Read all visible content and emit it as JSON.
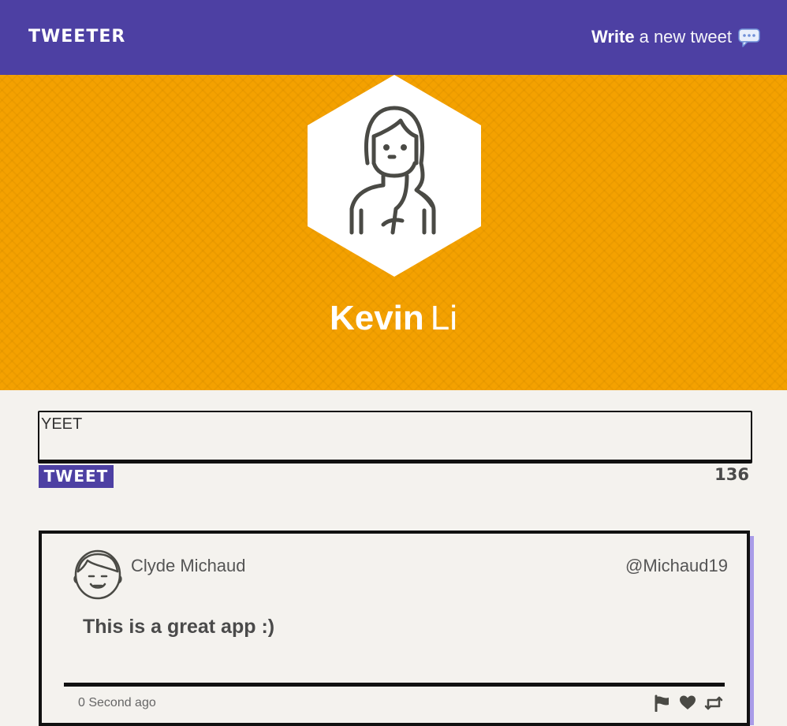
{
  "nav": {
    "brand": "TWEETER",
    "compose_bold": "Write",
    "compose_rest": "a new tweet",
    "compose_icon": "speech-bubble-icon",
    "bg_color": "#4d40a3"
  },
  "profile": {
    "first_name": "Kevin",
    "last_name": "Li",
    "avatar_icon": "woman-avatar-icon",
    "banner_color": "#f4a100"
  },
  "composer": {
    "value": "YEET",
    "button_label": "TWEET",
    "char_count": "136"
  },
  "tweets": [
    {
      "author": "Clyde Michaud",
      "handle": "@Michaud19",
      "text": "This is a great app :)",
      "timestamp": "0 Second ago",
      "avatar_icon": "man-avatar-icon",
      "actions": [
        "flag-icon",
        "heart-icon",
        "retweet-icon"
      ]
    }
  ]
}
